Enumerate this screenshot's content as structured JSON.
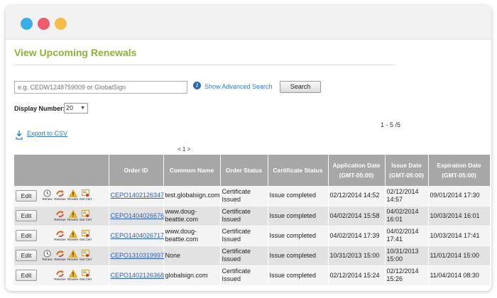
{
  "page": {
    "title": "View Upcoming Renewals"
  },
  "search": {
    "placeholder": "e.g. CEDW1248759009 or GlobalSign",
    "advanced_link": "Show Advanced Search",
    "button_label": "Search"
  },
  "display": {
    "label": "Display Number:",
    "selected": "20"
  },
  "range_text": "1 - 5 /5",
  "export_link": "Export to CSV",
  "pager": "< 1 >",
  "action_labels": {
    "renew": "Renew",
    "reissue": "Reissue",
    "revoke": "Revoke",
    "getcert": "Get Cert",
    "edit": "Edit"
  },
  "table": {
    "headers": {
      "order_id": "Order ID",
      "common_name": "Common Name",
      "order_status": "Order Status",
      "cert_status": "Certificate Status",
      "app_date": "Application Date",
      "app_date_tz": "(GMT-05:00)",
      "issue_date": "Issue Date",
      "issue_date_tz": "(GMT-05:00)",
      "exp_date": "Expiration Date",
      "exp_date_tz": "(GMT-05:00)"
    },
    "rows": [
      {
        "order_id": "CEPO1402126347",
        "common_name": "test.globalsign.com",
        "order_status": "Certificate Issued",
        "cert_status": "Issue completed",
        "app_date": "02/12/2014 14:52",
        "issue_date": "02/12/2014 14:57",
        "exp_date": "09/01/2014 17:30"
      },
      {
        "order_id": "CEPO1404026676",
        "common_name": "www.doug-beattie.com",
        "order_status": "Certificate Issued",
        "cert_status": "Issue completed",
        "app_date": "04/02/2014 15:58",
        "issue_date": "04/02/2014 16:01",
        "exp_date": "10/03/2014 16:01"
      },
      {
        "order_id": "CEPO1404026717",
        "common_name": "www.doug-beattie.com",
        "order_status": "Certificate Issued",
        "cert_status": "Issue completed",
        "app_date": "04/02/2014 17:39",
        "issue_date": "04/02/2014 17:41",
        "exp_date": "10/03/2014 17:41"
      },
      {
        "order_id": "CEPO1310319997",
        "common_name": "None",
        "order_status": "Certificate Issued",
        "cert_status": "Issue completed",
        "app_date": "10/31/2013 15:00",
        "issue_date": "10/31/2013 15:00",
        "exp_date": "11/01/2014 15:00"
      },
      {
        "order_id": "CEPO1402126368",
        "common_name": "globalsign.com",
        "order_status": "Certificate Issued",
        "cert_status": "Issue completed",
        "app_date": "02/12/2014 15:24",
        "issue_date": "02/12/2014 15:26",
        "exp_date": "11/04/2014 08:30"
      }
    ]
  },
  "colors": {
    "title_green": "#8cb43a",
    "link_blue": "#2a7ad6",
    "header_gray": "#a7a7a7"
  },
  "icons": {
    "renew": "clock-icon",
    "reissue": "reissue-arrows-icon",
    "revoke": "warning-triangle-icon",
    "getcert": "certificate-icon",
    "export": "download-drop-icon",
    "info": "info-icon"
  }
}
